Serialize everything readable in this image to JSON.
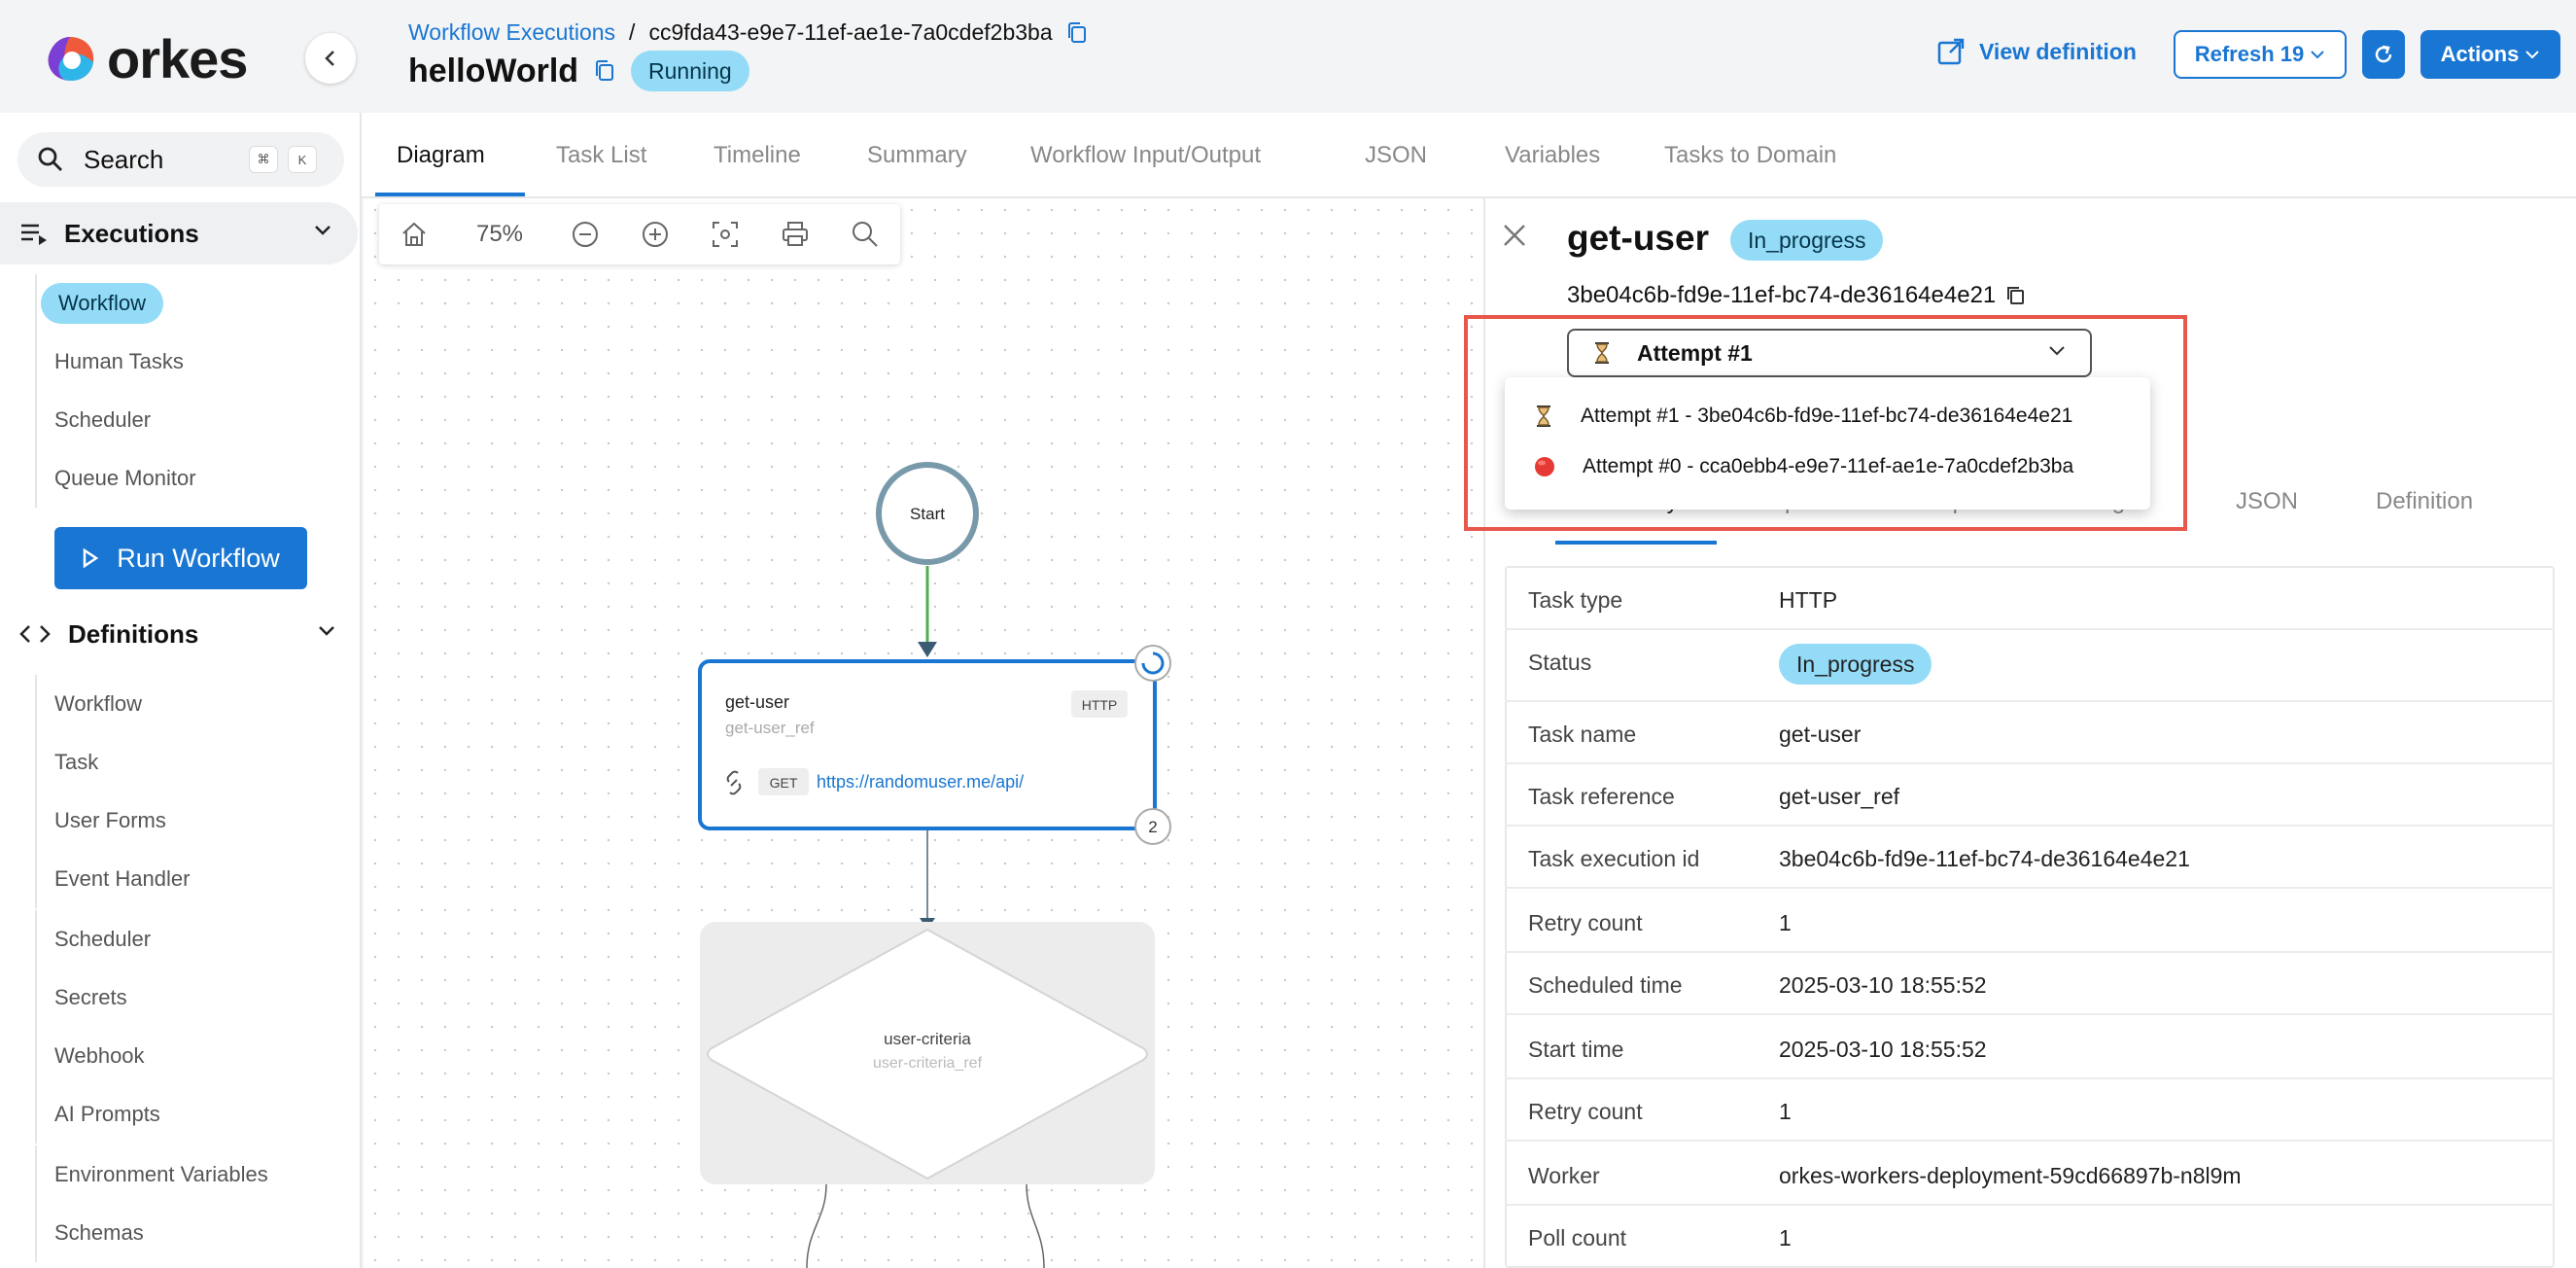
{
  "app": {
    "brand": "orkes"
  },
  "header": {
    "breadcrumb_link": "Workflow Executions",
    "breadcrumb_sep": "/",
    "execution_id": "cc9fda43-e9e7-11ef-ae1e-7a0cdef2b3ba",
    "workflow_name": "helloWorld",
    "status": "Running",
    "view_definition": "View definition",
    "refresh_label": "Refresh 19",
    "actions_label": "Actions"
  },
  "sidebar": {
    "search_label": "Search",
    "search_kbd_1": "⌘",
    "search_kbd_2": "K",
    "executions_label": "Executions",
    "executions_items": [
      "Workflow",
      "Human Tasks",
      "Scheduler",
      "Queue Monitor"
    ],
    "run_workflow": "Run Workflow",
    "definitions_label": "Definitions",
    "definitions_items": [
      "Workflow",
      "Task",
      "User Forms",
      "Event Handler",
      "Scheduler",
      "Secrets",
      "Webhook",
      "AI Prompts",
      "Environment Variables",
      "Schemas"
    ]
  },
  "tabs": [
    "Diagram",
    "Task List",
    "Timeline",
    "Summary",
    "Workflow Input/Output",
    "JSON",
    "Variables",
    "Tasks to Domain"
  ],
  "toolbar": {
    "zoom": "75%"
  },
  "diagram": {
    "start_label": "Start",
    "task_name": "get-user",
    "task_ref": "get-user_ref",
    "task_type": "HTTP",
    "method": "GET",
    "url": "https://randomuser.me/api/",
    "attempt_count": "2",
    "switch_name": "user-criteria",
    "switch_ref": "user-criteria_ref"
  },
  "panel": {
    "task_title": "get-user",
    "task_status": "In_progress",
    "task_id": "3be04c6b-fd9e-11ef-bc74-de36164e4e21",
    "selected_attempt": "Attempt #1",
    "attempts": [
      {
        "label": "Attempt #1 - 3be04c6b-fd9e-11ef-bc74-de36164e4e21",
        "icon": "hourglass-icon"
      },
      {
        "label": "Attempt #0 - cca0ebb4-e9e7-11ef-ae1e-7a0cdef2b3ba",
        "icon": "red-status-icon",
        "color": "#e53935"
      }
    ],
    "subtabs": [
      "Summary",
      "Input",
      "Output",
      "Logs",
      "JSON",
      "Definition"
    ],
    "details": [
      {
        "key": "Task type",
        "value": "HTTP"
      },
      {
        "key": "Status",
        "value": "In_progress"
      },
      {
        "key": "Task name",
        "value": "get-user"
      },
      {
        "key": "Task reference",
        "value": "get-user_ref"
      },
      {
        "key": "Task execution id",
        "value": "3be04c6b-fd9e-11ef-bc74-de36164e4e21"
      },
      {
        "key": "Retry count",
        "value": "1"
      },
      {
        "key": "Scheduled time",
        "value": "2025-03-10 18:55:52"
      },
      {
        "key": "Start time",
        "value": "2025-03-10 18:55:52"
      },
      {
        "key": "Retry count",
        "value": "1"
      },
      {
        "key": "Worker",
        "value": "orkes-workers-deployment-59cd66897b-n8l9m"
      },
      {
        "key": "Poll count",
        "value": "1"
      }
    ]
  },
  "colors": {
    "accent": "#1976d2",
    "status_pill": "#93dbf6",
    "highlight": "#e8574c"
  }
}
